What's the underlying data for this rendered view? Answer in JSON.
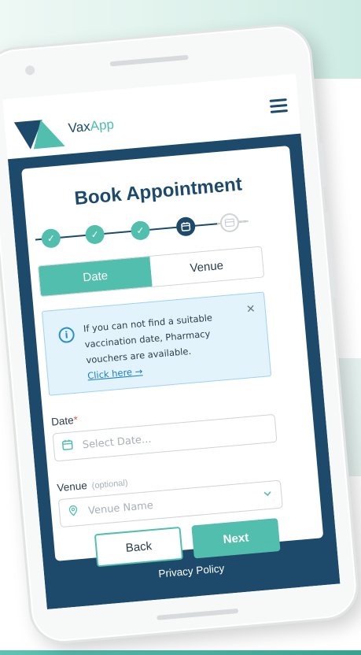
{
  "header": {
    "brand_part1": "Vax",
    "brand_part2": "App",
    "menu_icon": "hamburger-menu-icon"
  },
  "page": {
    "title": "Book Appointment"
  },
  "stepper": {
    "steps": [
      {
        "status": "done",
        "icon": "check-icon"
      },
      {
        "status": "done",
        "icon": "check-icon"
      },
      {
        "status": "done",
        "icon": "check-icon"
      },
      {
        "status": "active",
        "icon": "calendar-icon"
      },
      {
        "status": "pending",
        "icon": "card-icon"
      }
    ]
  },
  "tabs": {
    "date_label": "Date",
    "venue_label": "Venue",
    "selected": "Date"
  },
  "alert": {
    "message": "If you can not find a suitable vaccination date, Pharmacy vouchers are available.",
    "link_label": "Click here →",
    "info_icon": "info-icon",
    "close_icon": "close-icon"
  },
  "form": {
    "date_label": "Date",
    "date_required_mark": "*",
    "date_placeholder": "Select Date...",
    "venue_label": "Venue",
    "venue_optional": "(optional)",
    "venue_placeholder": "Venue Name"
  },
  "buttons": {
    "back_label": "Back",
    "next_label": "Next"
  },
  "footer": {
    "privacy_label": "Privacy Policy"
  },
  "colors": {
    "teal": "#52bfae",
    "navy": "#1d4a6b",
    "alert_bg": "#e3f3fb"
  }
}
